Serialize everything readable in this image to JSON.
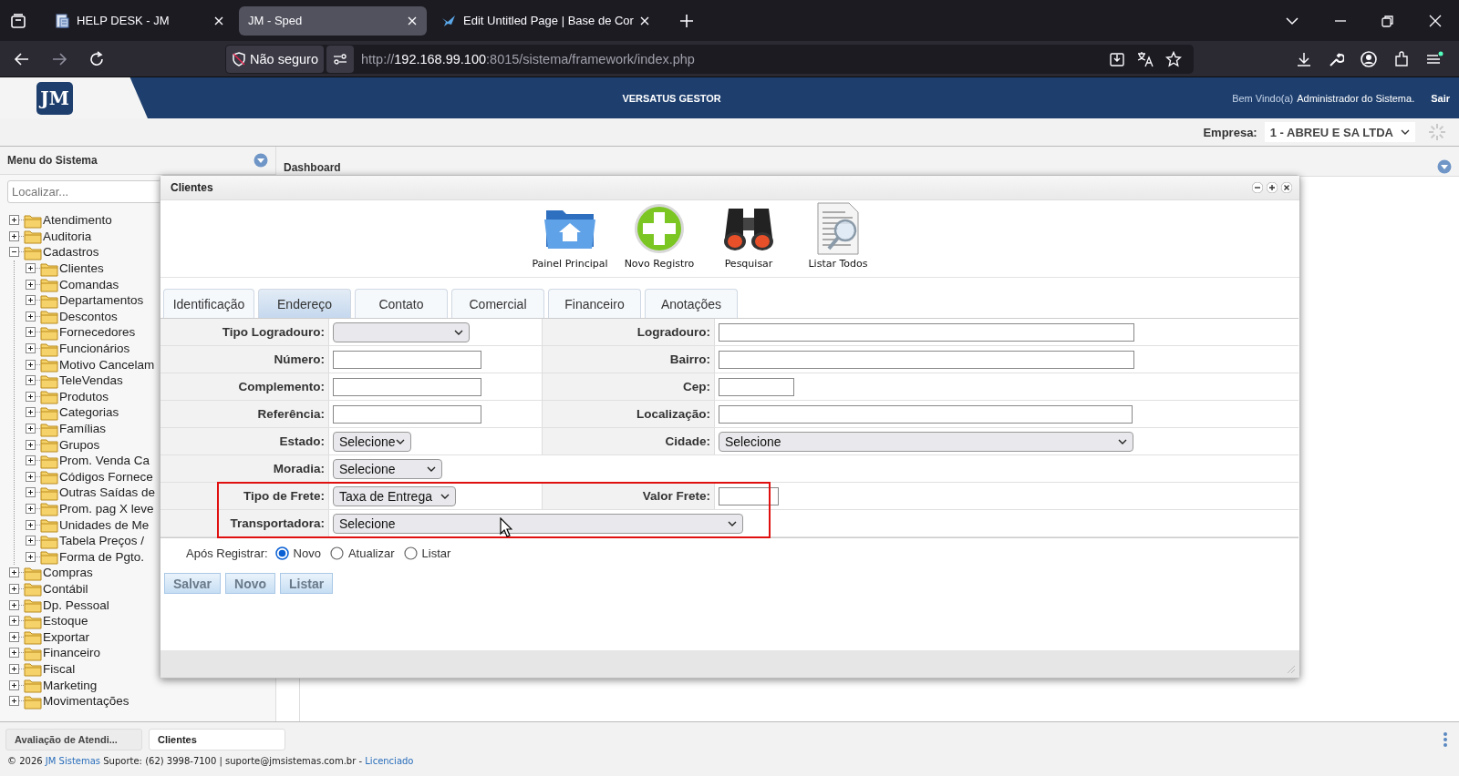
{
  "browser": {
    "tabs": [
      {
        "title": "HELP DESK - JM",
        "kind": "document",
        "selected": false
      },
      {
        "title": "JM - Sped",
        "kind": "plain",
        "selected": true
      },
      {
        "title": "Edit Untitled Page | Base de Cor",
        "kind": "bird",
        "selected": false
      }
    ],
    "security": "Não seguro",
    "url": {
      "scheme": "http://",
      "host": "192.168.99.100",
      "rest": ":8015/sistema/framework/index.php"
    }
  },
  "header": {
    "logo_text": "JM",
    "title": "VERSATUS GESTOR",
    "welcome": "Bem Vindo(a)",
    "user": "Administrador do Sistema.",
    "logout": "Sair"
  },
  "company": {
    "label": "Empresa:",
    "value": "1 - ABREU E SA LTDA"
  },
  "sidebar": {
    "title": "Menu do Sistema",
    "search": {
      "placeholder": "Localizar..."
    },
    "items": [
      {
        "label": "Atendimento",
        "expanded": false
      },
      {
        "label": "Auditoria",
        "expanded": false
      },
      {
        "label": "Cadastros",
        "expanded": true,
        "children": [
          {
            "label": "Clientes",
            "expanded": false
          },
          {
            "label": "Comandas",
            "expanded": false
          },
          {
            "label": "Departamentos",
            "expanded": false
          },
          {
            "label": "Descontos",
            "expanded": false
          },
          {
            "label": "Fornecedores",
            "expanded": false
          },
          {
            "label": "Funcionários",
            "expanded": false
          },
          {
            "label": "Motivo Cancelam",
            "expanded": false
          },
          {
            "label": "TeleVendas",
            "expanded": false
          },
          {
            "label": "Produtos",
            "expanded": false
          },
          {
            "label": "Categorias",
            "expanded": false
          },
          {
            "label": "Famílias",
            "expanded": false
          },
          {
            "label": "Grupos",
            "expanded": false
          },
          {
            "label": "Prom. Venda Ca",
            "expanded": false
          },
          {
            "label": "Códigos Fornece",
            "expanded": false
          },
          {
            "label": "Outras Saídas de",
            "expanded": false
          },
          {
            "label": "Prom. pag X leve",
            "expanded": false
          },
          {
            "label": "Unidades de Me",
            "expanded": false
          },
          {
            "label": "Tabela Preços /",
            "expanded": false
          },
          {
            "label": "Forma de Pgto.",
            "expanded": false
          }
        ]
      },
      {
        "label": "Compras",
        "expanded": false
      },
      {
        "label": "Contábil",
        "expanded": false
      },
      {
        "label": "Dp. Pessoal",
        "expanded": false
      },
      {
        "label": "Estoque",
        "expanded": false
      },
      {
        "label": "Exportar",
        "expanded": false
      },
      {
        "label": "Financeiro",
        "expanded": false
      },
      {
        "label": "Fiscal",
        "expanded": false
      },
      {
        "label": "Marketing",
        "expanded": false
      },
      {
        "label": "Movimentações",
        "expanded": false
      }
    ]
  },
  "dashboard": {
    "title": "Dashboard"
  },
  "dialog": {
    "title": "Clientes",
    "toolbar": [
      {
        "label": "Painel Principal",
        "kind": "home"
      },
      {
        "label": "Novo Registro",
        "kind": "new"
      },
      {
        "label": "Pesquisar",
        "kind": "search"
      },
      {
        "label": "Listar Todos",
        "kind": "list"
      }
    ],
    "tabs": [
      {
        "label": "Identificação",
        "selected": false
      },
      {
        "label": "Endereço",
        "selected": true
      },
      {
        "label": "Contato",
        "selected": false
      },
      {
        "label": "Comercial",
        "selected": false
      },
      {
        "label": "Financeiro",
        "selected": false
      },
      {
        "label": "Anotações",
        "selected": false
      }
    ],
    "rows": [
      {
        "fields": [
          {
            "label": "Tipo Logradouro:",
            "kind": "select"
          },
          {
            "label": "Logradouro:",
            "kind": "text"
          }
        ]
      },
      {
        "fields": [
          {
            "label": "Número:",
            "kind": "text"
          },
          {
            "label": "Bairro:",
            "kind": "text"
          }
        ]
      },
      {
        "fields": [
          {
            "label": "Complemento:",
            "kind": "text"
          },
          {
            "label": "Cep:",
            "kind": "text"
          }
        ]
      },
      {
        "fields": [
          {
            "label": "Referência:",
            "kind": "text"
          },
          {
            "label": "Localização:",
            "kind": "text"
          }
        ]
      },
      {
        "fields": [
          {
            "label": "Estado:",
            "kind": "select",
            "value": "Selecione"
          },
          {
            "label": "Cidade:",
            "kind": "select",
            "value": "Selecione"
          }
        ]
      },
      {
        "fields": [
          {
            "label": "Moradia:",
            "kind": "select",
            "value": "Selecione"
          }
        ]
      },
      {
        "fields": [
          {
            "label": "Tipo de Frete:",
            "kind": "select",
            "value": "Taxa de Entrega"
          },
          {
            "label": "Valor Frete:",
            "kind": "text"
          }
        ]
      },
      {
        "fields": [
          {
            "label": "Transportadora:",
            "kind": "select",
            "value": "Selecione"
          }
        ]
      }
    ],
    "after_register": {
      "label": "Após Registrar:",
      "options": [
        {
          "label": "Novo",
          "selected": true
        },
        {
          "label": "Atualizar",
          "selected": false
        },
        {
          "label": "Listar",
          "selected": false
        }
      ]
    },
    "buttons": [
      "Salvar",
      "Novo",
      "Listar"
    ]
  },
  "taskbar": [
    {
      "label": "Avaliação de Atendi...",
      "selected": false
    },
    {
      "label": "Clientes",
      "selected": true
    }
  ],
  "footer": {
    "copyright": "© 2026",
    "company_link": "JM Sistemas",
    "support": "Suporte: (62) 3998-7100 | suporte@jmsistemas.com.br -",
    "license_link": "Licenciado"
  }
}
